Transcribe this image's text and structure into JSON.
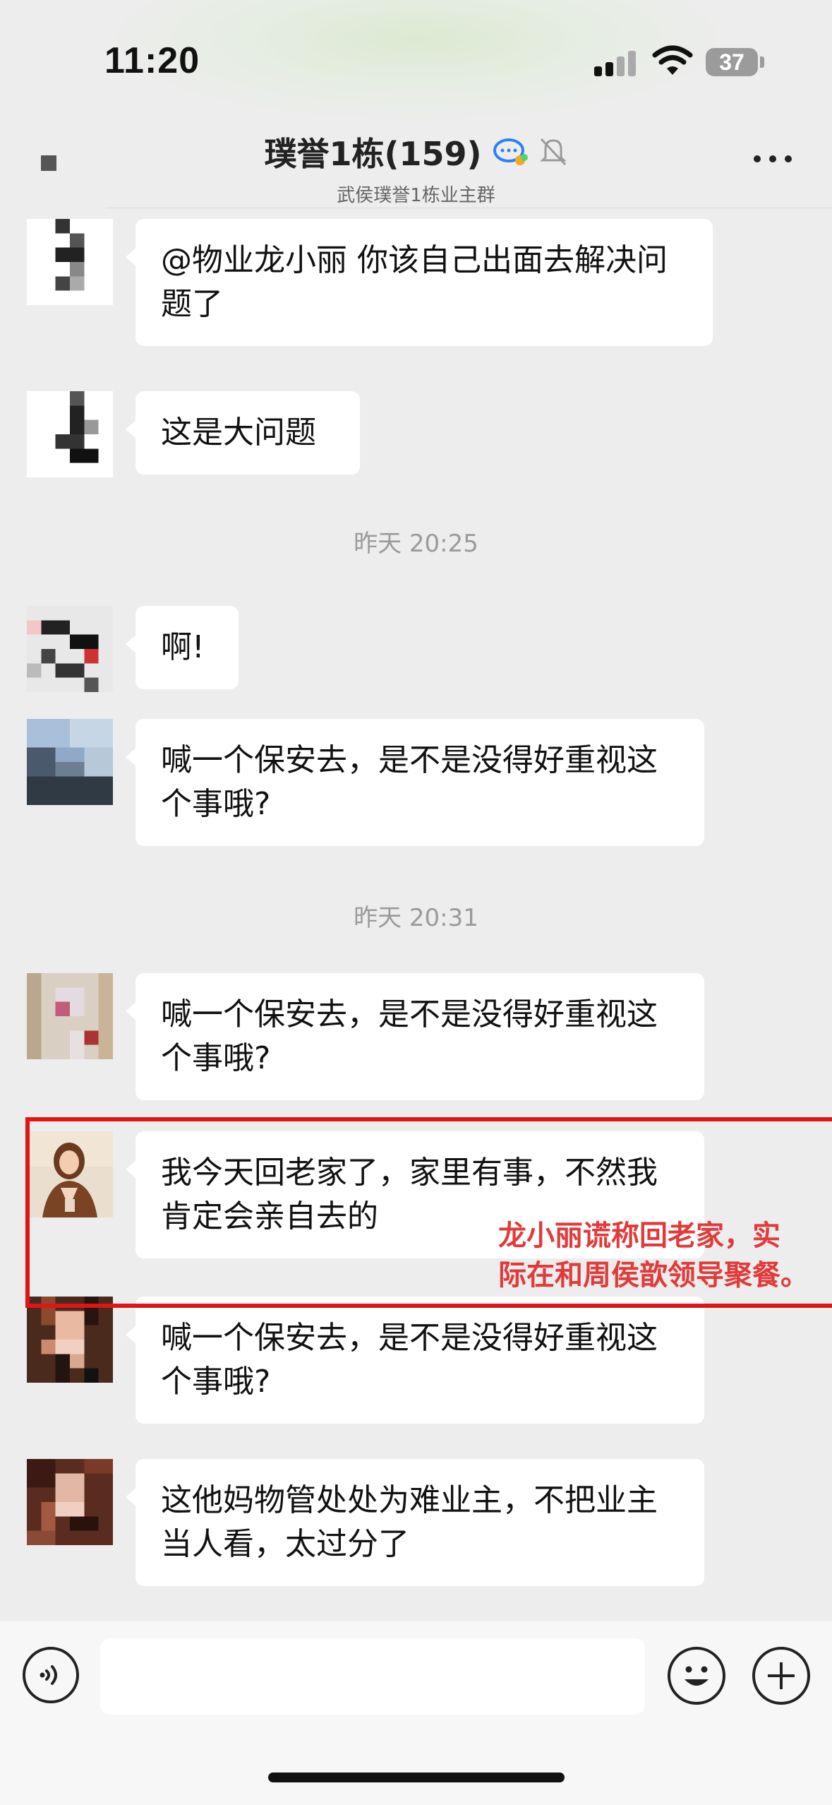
{
  "status_bar": {
    "time": "11:20",
    "battery": "37",
    "icons": [
      "signal-icon",
      "wifi-icon",
      "battery-icon"
    ]
  },
  "nav": {
    "title": "璞誉1栋(159)",
    "subtitle": "武侯璞誉1栋业主群",
    "icons": [
      "back-icon",
      "chat-bubble-icon",
      "mute-bell-icon",
      "more-icon"
    ]
  },
  "messages": [
    {
      "text": "@物业龙小丽 你该自己出面去解决问题了"
    },
    {
      "text": "这是大问题"
    },
    {
      "timestamp": "昨天 20:25"
    },
    {
      "text": "啊!"
    },
    {
      "text": "喊一个保安去，是不是没得好重视这个事哦?"
    },
    {
      "timestamp": "昨天 20:31"
    },
    {
      "text": "喊一个保安去，是不是没得好重视这个事哦?"
    },
    {
      "text": "我今天回老家了，家里有事，不然我肯定会亲自去的"
    },
    {
      "text": "喊一个保安去，是不是没得好重视这个事哦?"
    },
    {
      "text": "这他妈物管处处为难业主，不把业主当人看，太过分了"
    }
  ],
  "annotation": {
    "line1": "龙小丽谎称回老家，实",
    "line2": "际在和周侯歆领导聚餐。",
    "color": "#e23a3a",
    "box_color": "#e01515"
  },
  "input_bar": {
    "icons": [
      "voice-icon",
      "emoji-icon",
      "plus-icon"
    ]
  },
  "colors": {
    "background": "#ededed",
    "bubble": "#ffffff"
  }
}
